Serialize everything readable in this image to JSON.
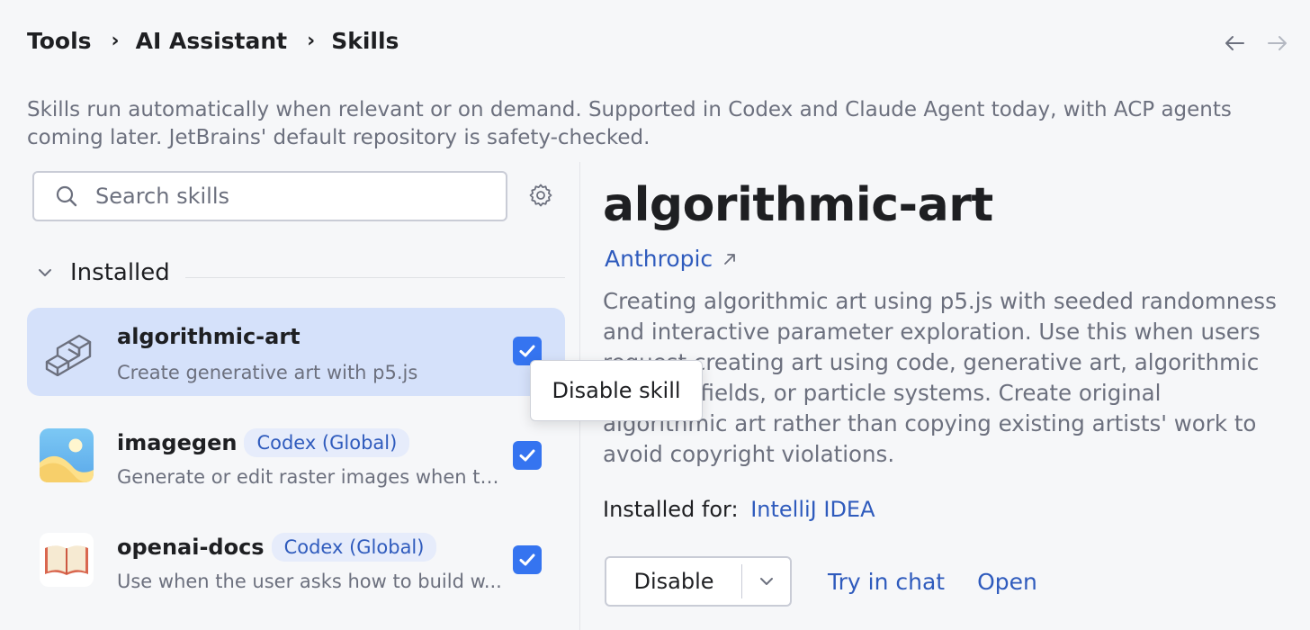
{
  "breadcrumb": {
    "items": [
      "Tools",
      "AI Assistant",
      "Skills"
    ],
    "separator": "›"
  },
  "description": "Skills run automatically when relevant or on demand. Supported in Codex and Claude Agent today, with ACP agents coming later. JetBrains' default repository is safety-checked.",
  "search": {
    "placeholder": "Search skills",
    "value": ""
  },
  "group": {
    "label": "Installed",
    "expanded": true
  },
  "skills": [
    {
      "name": "algorithmic-art",
      "badge": "",
      "description": "Create generative art with p5.js",
      "enabled": true,
      "selected": true,
      "icon": "stairs-icon"
    },
    {
      "name": "imagegen",
      "badge": "Codex (Global)",
      "description": "Generate or edit raster images when th...",
      "enabled": true,
      "selected": false,
      "icon": "image-icon"
    },
    {
      "name": "openai-docs",
      "badge": "Codex (Global)",
      "description": "Use when the user asks how to build w...",
      "enabled": true,
      "selected": false,
      "icon": "book-icon"
    }
  ],
  "tooltip": "Disable skill",
  "detail": {
    "title": "algorithmic-art",
    "author": "Anthropic",
    "description": "Creating algorithmic art using p5.js with seeded randomness and interactive parameter exploration. Use this when users request creating art using code, generative art, algorithmic art, flow fields, or particle systems. Create original algorithmic art rather than copying existing artists' work to avoid copyright violations.",
    "installed_for_label": "Installed for:",
    "installed_for_value": "IntelliJ IDEA",
    "disable_button": "Disable",
    "try_in_chat": "Try in chat",
    "open": "Open"
  },
  "colors": {
    "accent": "#3574f0",
    "link": "#2f5bbd",
    "selected_bg": "#d5e1fa",
    "muted_text": "#6c707e"
  }
}
